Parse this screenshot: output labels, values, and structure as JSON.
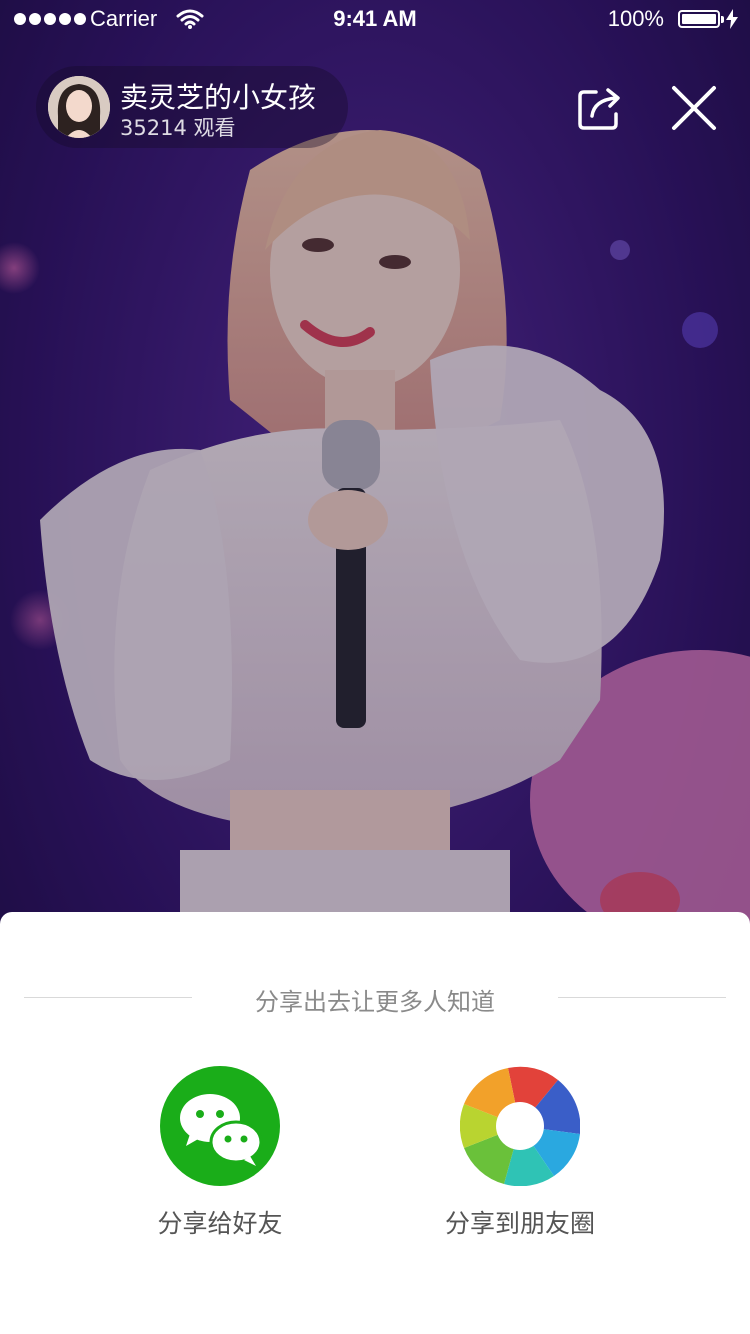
{
  "status_bar": {
    "carrier": "Carrier",
    "time": "9:41 AM",
    "battery": "100%"
  },
  "live": {
    "host_name": "卖灵芝的小女孩",
    "viewers": "35214 观看"
  },
  "share_sheet": {
    "title": "分享出去让更多人知道",
    "options": [
      {
        "label": "分享给好友",
        "icon": "wechat-icon",
        "color": "#1aad19"
      },
      {
        "label": "分享到朋友圈",
        "icon": "moments-icon",
        "color": "#4c8bf5"
      }
    ]
  },
  "colors": {
    "stage_purple": "#3a1a78",
    "stage_pink": "#c65aa8",
    "sheet_bg": "#ffffff",
    "wechat_green": "#1aad19"
  }
}
